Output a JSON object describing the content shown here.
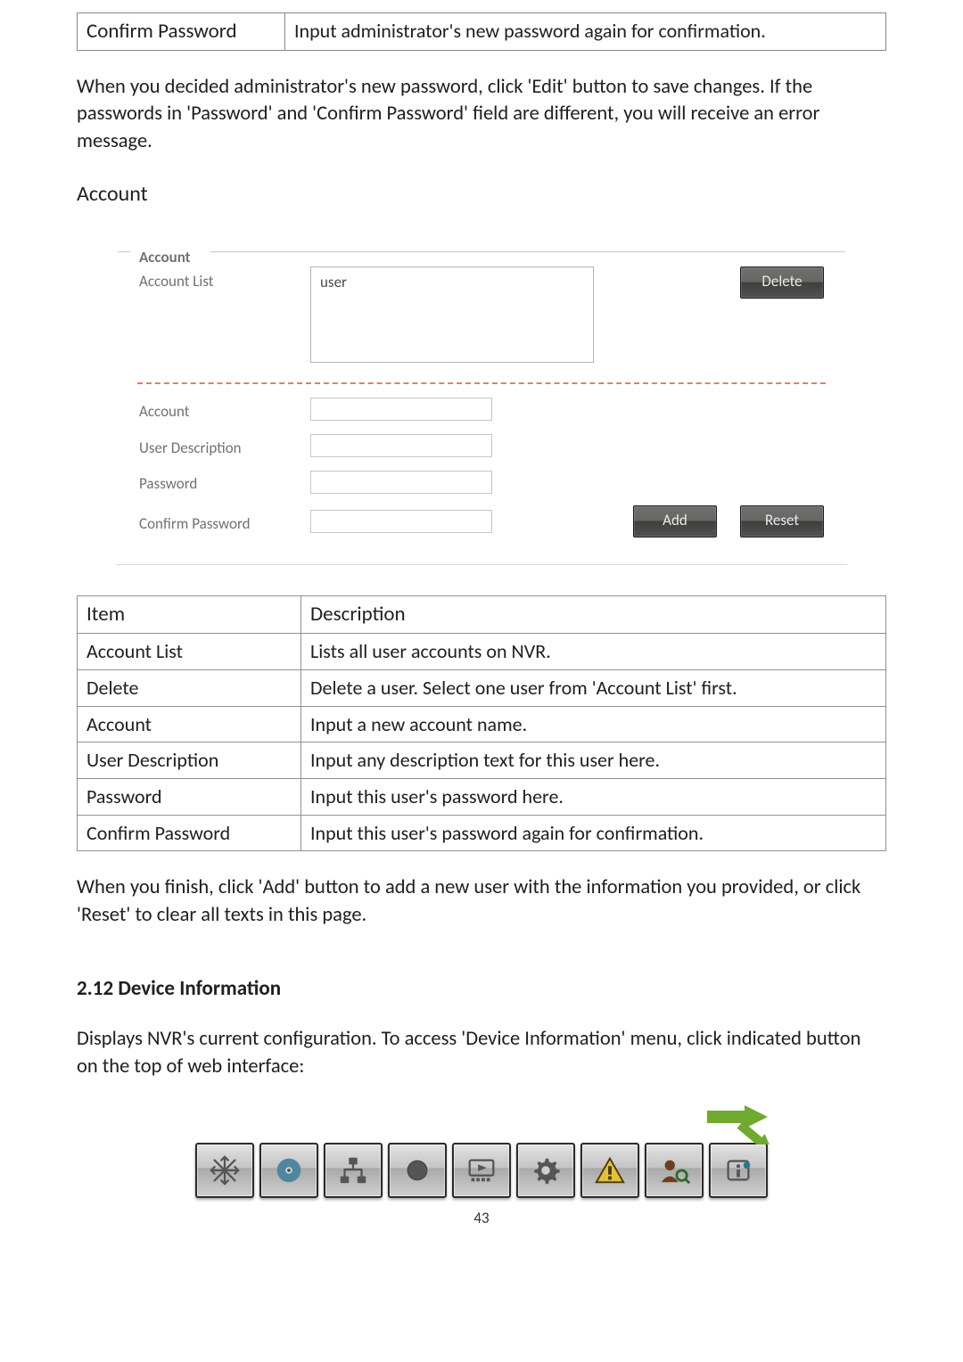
{
  "top_row": {
    "key": "Confirm Password",
    "value": "Input administrator's new password again for confirmation."
  },
  "para1": "When you decided administrator's new password, click 'Edit' button to save changes. If the passwords in 'Password' and 'Confirm Password' field are different, you will receive an error message.",
  "account_heading": "Account",
  "panel": {
    "legend": "Account",
    "account_list_label": "Account List",
    "list_options": [
      "user"
    ],
    "btn_delete": "Delete",
    "labels": {
      "account": "Account",
      "user_desc": "User Description",
      "password": "Password",
      "confirm_password": "Confirm Password"
    },
    "btn_add": "Add",
    "btn_reset": "Reset"
  },
  "desc_table": {
    "head": {
      "item": "Item",
      "desc": "Description"
    },
    "rows": [
      {
        "k": "Account List",
        "v": "Lists all user accounts on NVR."
      },
      {
        "k": "Delete",
        "v": "Delete a user. Select one user from 'Account List' first."
      },
      {
        "k": "Account",
        "v": "Input a new account name."
      },
      {
        "k": "User Description",
        "v": "Input any description text for this user here."
      },
      {
        "k": "Password",
        "v": "Input this user's password here."
      },
      {
        "k": "Confirm Password",
        "v": "Input this user's password again for confirmation."
      }
    ]
  },
  "para2": "When you finish, click 'Add' button to add a new user with the information you provided, or click 'Reset' to clear all texts in this page.",
  "section_title": "2.12 Device Information",
  "para3": "Displays NVR's current configuration. To access 'Device Information' menu, click indicated button on the top of web interface:",
  "toolbar_icons": [
    "snowflake-icon",
    "disc-icon",
    "network-icon",
    "record-icon",
    "screen-icon",
    "gear-icon",
    "alert-icon",
    "user-icon",
    "info-icon"
  ],
  "page_number": "43"
}
